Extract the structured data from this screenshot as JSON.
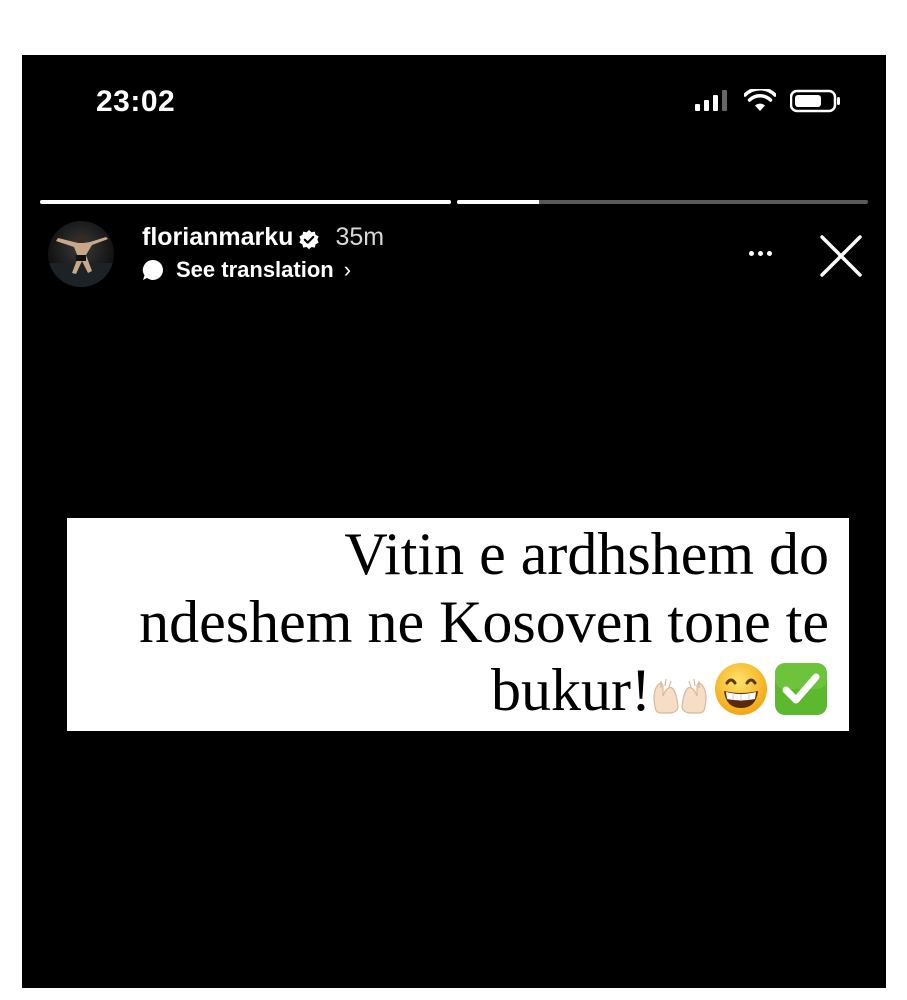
{
  "status_bar": {
    "time": "23:02"
  },
  "story": {
    "progress_segments": [
      1.0,
      0.2
    ],
    "username": "florianmarku",
    "verified": true,
    "time_ago": "35m",
    "translate_label": "See translation",
    "translate_chevron": "›"
  },
  "sticker": {
    "line1": "Vitin e ardhshem do",
    "line2": "ndeshem ne Kosoven tone te",
    "line3": "bukur!",
    "emojis": [
      "palms-up-together-icon",
      "grinning-face-icon",
      "check-mark-button-icon"
    ]
  },
  "colors": {
    "background": "#000000",
    "sticker_bg": "#ffffff",
    "check_green": "#5cb82f"
  }
}
